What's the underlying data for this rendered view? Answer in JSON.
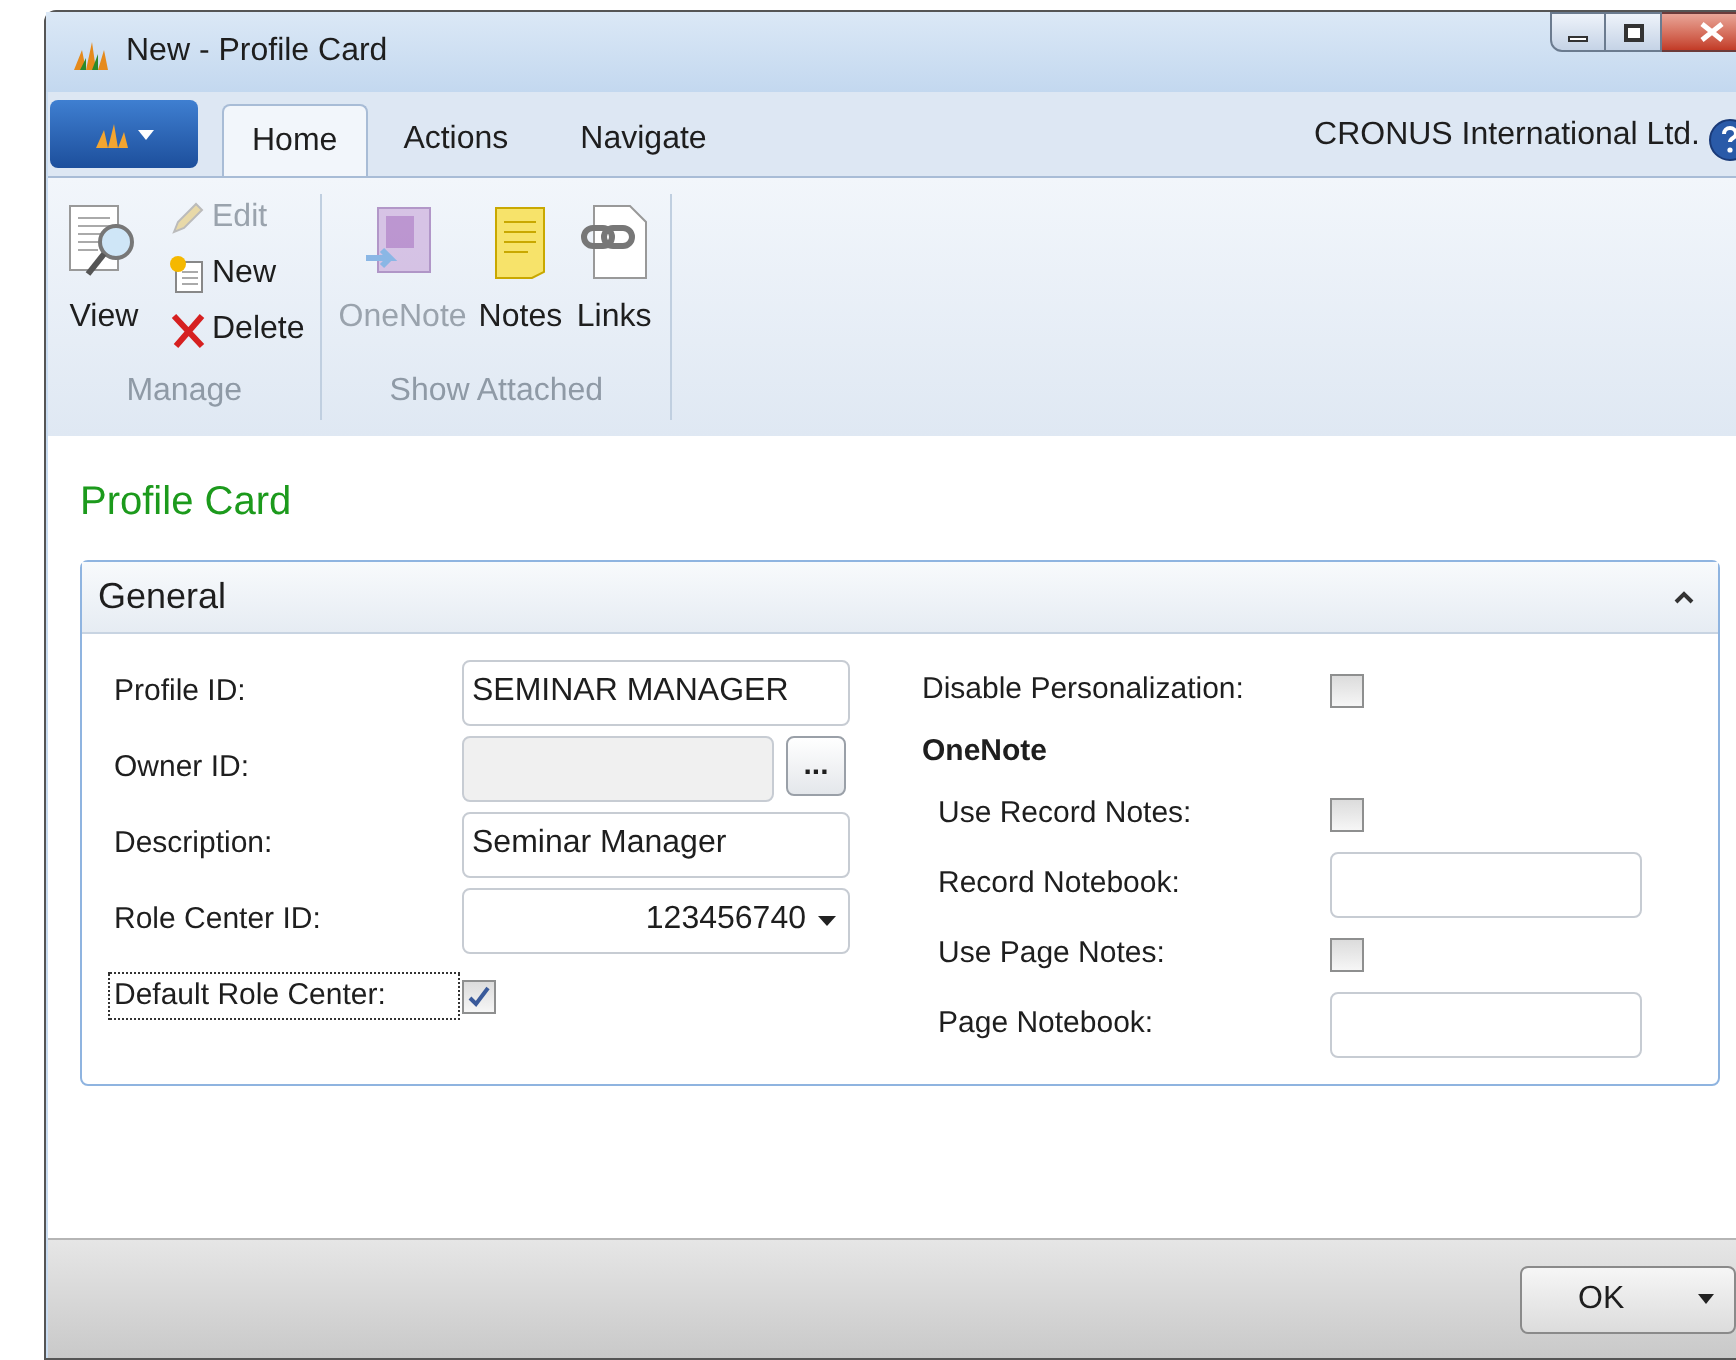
{
  "window": {
    "title": "New - Profile Card"
  },
  "tabs": [
    {
      "label": "Home",
      "selected": true
    },
    {
      "label": "Actions",
      "selected": false
    },
    {
      "label": "Navigate",
      "selected": false
    }
  ],
  "company": "CRONUS International Ltd.",
  "ribbon": {
    "groups": [
      {
        "label": "Manage",
        "items": [
          {
            "kind": "large",
            "label": "View",
            "disabled": false
          },
          {
            "kind": "small",
            "label": "Edit",
            "disabled": true
          },
          {
            "kind": "small",
            "label": "New",
            "disabled": false
          },
          {
            "kind": "small",
            "label": "Delete",
            "disabled": false
          }
        ]
      },
      {
        "label": "Show Attached",
        "items": [
          {
            "kind": "large",
            "label": "OneNote",
            "disabled": true
          },
          {
            "kind": "large",
            "label": "Notes",
            "disabled": false
          },
          {
            "kind": "large",
            "label": "Links",
            "disabled": false
          }
        ]
      }
    ]
  },
  "page_title": "Profile Card",
  "fasttab": {
    "title": "General",
    "expanded": true,
    "left": [
      {
        "kind": "text",
        "label": "Profile ID:",
        "value": "SEMINAR MANAGER",
        "focused": false
      },
      {
        "kind": "lookup",
        "label": "Owner ID:",
        "button": "...",
        "focused": false
      },
      {
        "kind": "text",
        "label": "Description:",
        "value": "Seminar Manager",
        "focused": false
      },
      {
        "kind": "dropdown",
        "label": "Role Center ID:",
        "value": "123456740",
        "focused": false
      },
      {
        "kind": "checkbox",
        "label": "Default Role Center:",
        "checked": true,
        "focused": true
      }
    ],
    "right": [
      {
        "kind": "checkbox",
        "label": "Disable Personalization:",
        "checked": false
      },
      {
        "kind": "section",
        "label": "OneNote",
        "children": [
          {
            "kind": "checkbox",
            "label": "Use Record Notes:",
            "checked": false
          },
          {
            "kind": "text",
            "label": "Record Notebook:"
          },
          {
            "kind": "checkbox",
            "label": "Use Page Notes:",
            "checked": false
          },
          {
            "kind": "text",
            "label": "Page Notebook:"
          }
        ]
      }
    ]
  },
  "ok_button": {
    "label": "OK"
  }
}
